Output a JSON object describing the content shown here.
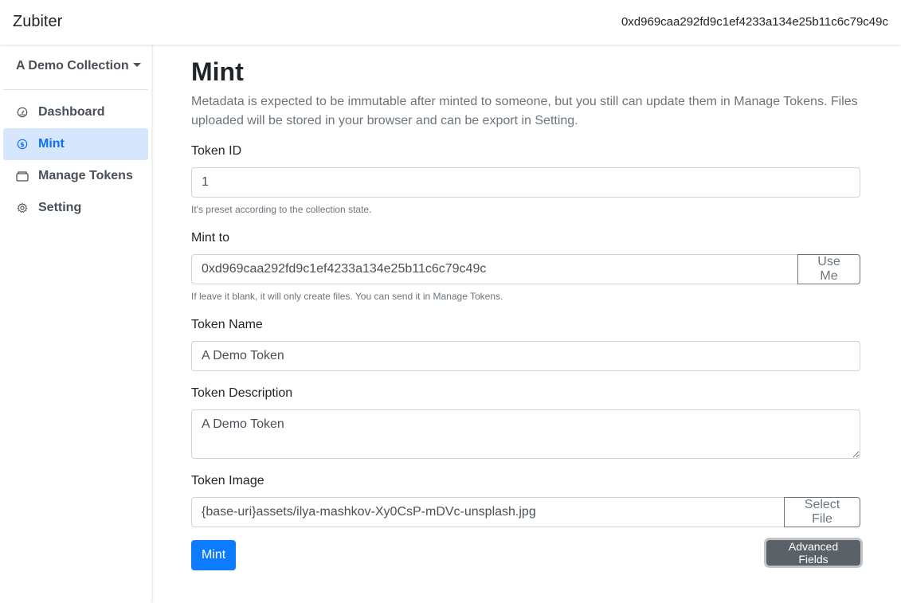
{
  "topbar": {
    "brand": "Zubiter",
    "account_address": "0xd969caa292fd9c1ef4233a134e25b11c6c79c49c"
  },
  "sidebar": {
    "collection_label": "A Demo Collection",
    "items": [
      {
        "label": "Dashboard",
        "icon": "speedometer-icon",
        "active": false
      },
      {
        "label": "Mint",
        "icon": "dollar-circle-icon",
        "active": true
      },
      {
        "label": "Manage Tokens",
        "icon": "wallet-icon",
        "active": false
      },
      {
        "label": "Setting",
        "icon": "gear-icon",
        "active": false
      }
    ]
  },
  "main": {
    "title": "Mint",
    "description": "Metadata is expected to be immutable after minted to someone, but you still can update them in Manage Tokens. Files uploaded will be stored in your browser and can be export in Setting.",
    "token_id": {
      "label": "Token ID",
      "value": "1",
      "help": "It's preset according to the collection state."
    },
    "mint_to": {
      "label": "Mint to",
      "value": "0xd969caa292fd9c1ef4233a134e25b11c6c79c49c",
      "button": "Use Me",
      "help": "If leave it blank, it will only create files. You can send it in Manage Tokens."
    },
    "token_name": {
      "label": "Token Name",
      "value": "A Demo Token"
    },
    "token_description": {
      "label": "Token Description",
      "value": "A Demo Token"
    },
    "token_image": {
      "label": "Token Image",
      "value": "{base-uri}assets/ilya-mashkov-Xy0CsP-mDVc-unsplash.jpg",
      "button": "Select File"
    },
    "mint_button": "Mint",
    "advanced_button": "Advanced Fields"
  },
  "colors": {
    "primary": "#0d7bfd",
    "active_nav_bg": "#d6e7fd",
    "secondary": "#5a6268"
  }
}
